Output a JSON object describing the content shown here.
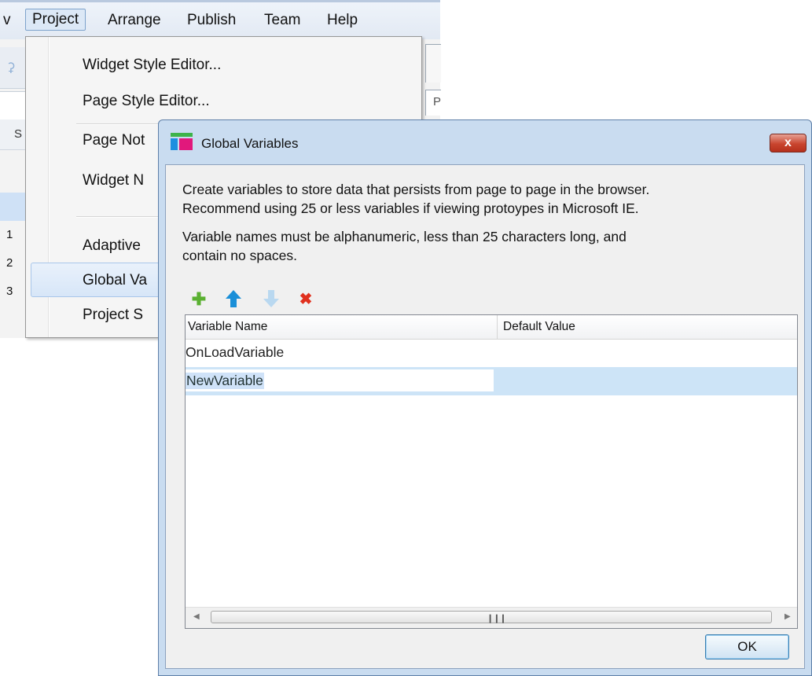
{
  "menubar": {
    "items": [
      "v",
      "Project",
      "Arrange",
      "Publish",
      "Team",
      "Help"
    ]
  },
  "background_app": {
    "pages_header_letter": "S",
    "row_numbers": [
      "1",
      "2",
      "3"
    ],
    "right_box_letter": "P"
  },
  "dropdown": {
    "items": [
      "Widget Style Editor...",
      "Page Style Editor...",
      "Page Not",
      "Widget N",
      "Adaptive",
      "Global Va",
      "Project S"
    ]
  },
  "dialog": {
    "title": "Global Variables",
    "close_label": "x",
    "description_line1": "Create variables to store data that persists from page to page in the browser.",
    "description_line2": "Recommend using 25 or less variables if viewing protoypes in Microsoft IE.",
    "rules_line1": "Variable names must be alphanumeric, less than 25 characters long, and",
    "rules_line2": "contain no spaces.",
    "toolbar": {
      "add_icon": "plus-icon",
      "move_up_icon": "arrow-up-icon",
      "move_down_icon": "arrow-down-icon",
      "delete_icon": "delete-x-icon"
    },
    "table": {
      "columns": [
        "Variable Name",
        "Default Value"
      ],
      "rows": [
        {
          "name": "OnLoadVariable",
          "default": ""
        },
        {
          "name": "NewVariable",
          "default": ""
        }
      ]
    },
    "ok_label": "OK"
  },
  "colors": {
    "add_green": "#5ab031",
    "arrow_blue": "#1a8fd8",
    "arrow_disabled": "#b9d8f0",
    "delete_red": "#e0301e",
    "selection": "#cde4f7"
  }
}
